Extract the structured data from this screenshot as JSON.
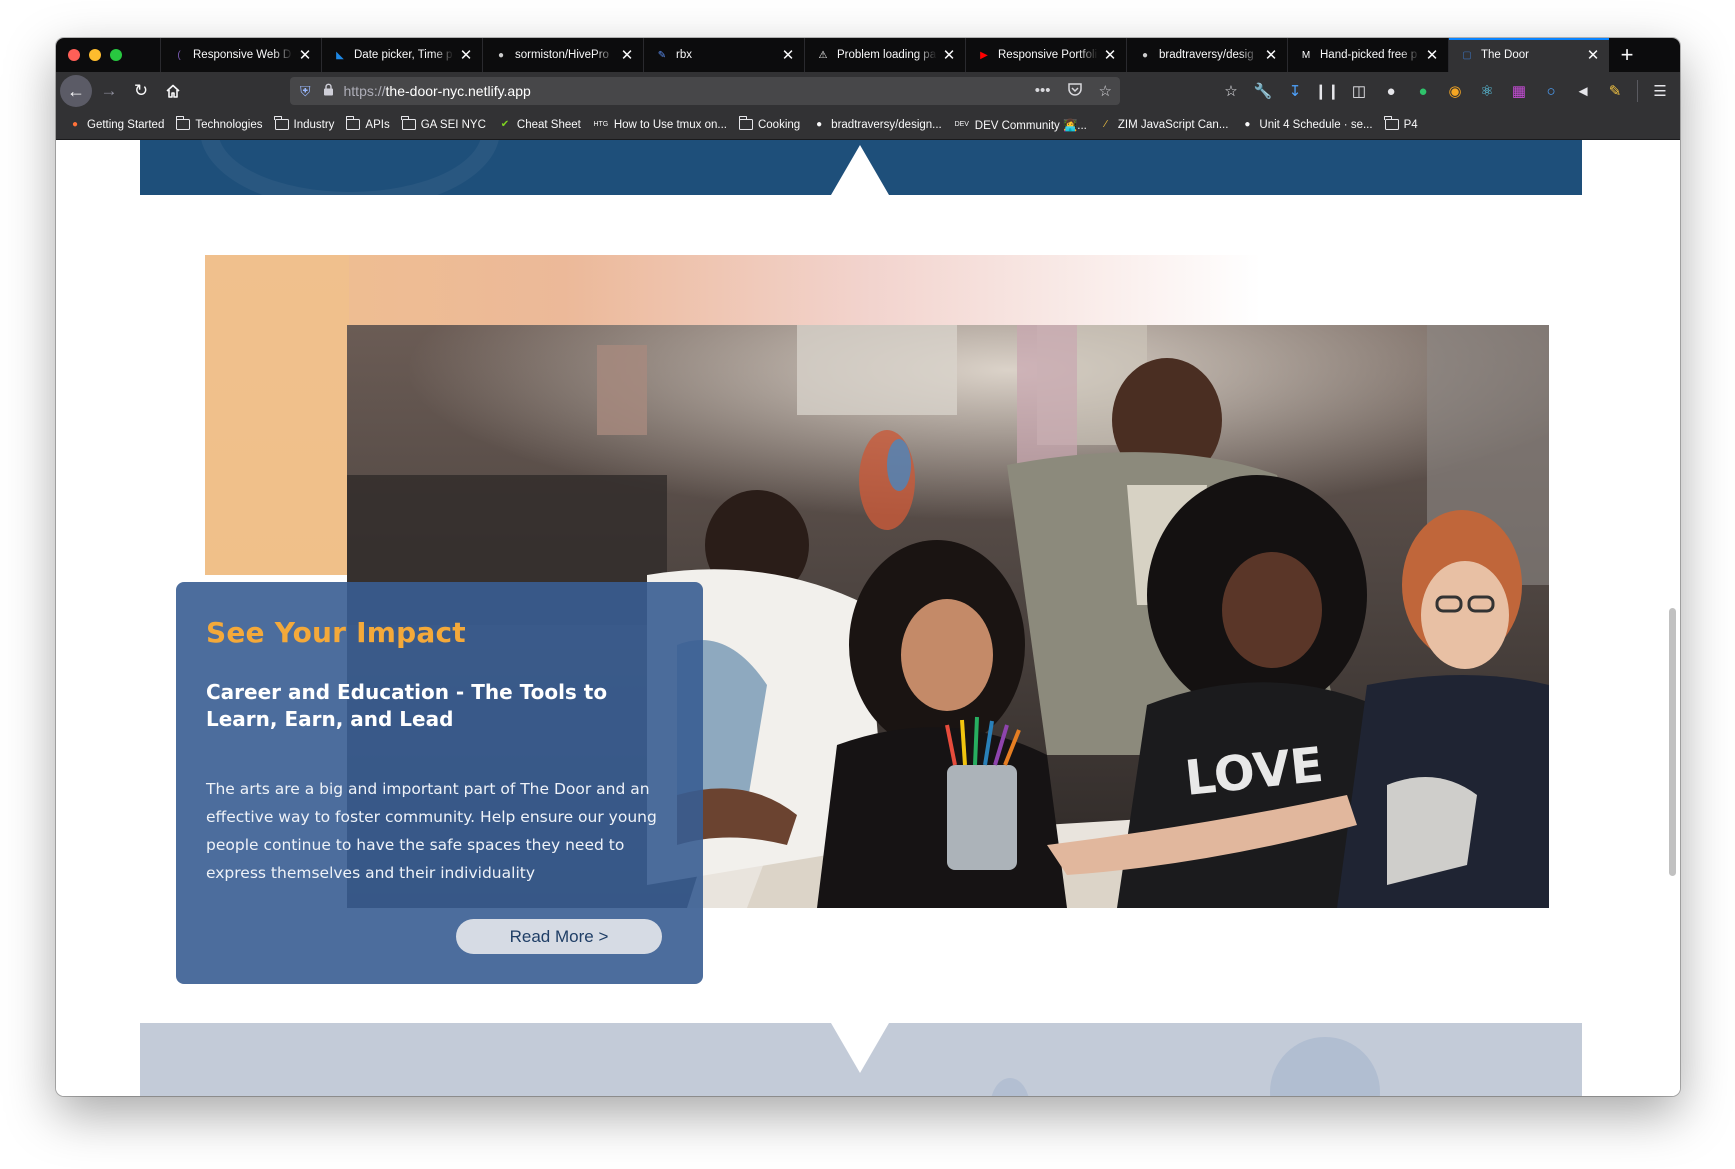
{
  "browser": {
    "tabs": [
      {
        "title": "Responsive Web D",
        "favicon": "heroku-icon",
        "color": "#7a5bb5",
        "active": false
      },
      {
        "title": "Date picker, Time p",
        "favicon": "mui-icon",
        "color": "#1e88e5",
        "active": false
      },
      {
        "title": "sormiston/HivePro",
        "favicon": "github-icon",
        "color": "#cccccc",
        "active": false
      },
      {
        "title": "rbx",
        "favicon": "rbx-icon",
        "color": "#5b8def",
        "active": false
      },
      {
        "title": "Problem loading pa",
        "favicon": "warning-icon",
        "color": "#ffffff",
        "active": false
      },
      {
        "title": "Responsive Portfoli",
        "favicon": "youtube-icon",
        "color": "#ff0000",
        "active": false
      },
      {
        "title": "bradtraversy/desig",
        "favicon": "github-icon",
        "color": "#cccccc",
        "active": false
      },
      {
        "title": "Hand-picked free p",
        "favicon": "m-icon",
        "color": "#ffffff",
        "active": false
      },
      {
        "title": "The Door",
        "favicon": "door-icon",
        "color": "#3b6fb6",
        "active": true
      }
    ],
    "url_protocol": "https://",
    "url_host": "the-door-nyc.netlify.app",
    "bookmarks": [
      {
        "label": "Getting Started",
        "icon": "firefox-icon"
      },
      {
        "label": "Technologies",
        "icon": "folder-icon"
      },
      {
        "label": "Industry",
        "icon": "folder-icon"
      },
      {
        "label": "APIs",
        "icon": "folder-icon"
      },
      {
        "label": "GA SEI NYC",
        "icon": "folder-icon"
      },
      {
        "label": "Cheat Sheet",
        "icon": "leaf-icon"
      },
      {
        "label": "How to Use tmux on...",
        "icon": "htg-icon"
      },
      {
        "label": "Cooking",
        "icon": "folder-icon"
      },
      {
        "label": "bradtraversy/design...",
        "icon": "github-icon"
      },
      {
        "label": "DEV Community 👩‍💻...",
        "icon": "dev-icon"
      },
      {
        "label": "ZIM JavaScript Can...",
        "icon": "zim-icon"
      },
      {
        "label": "Unit 4 Schedule · se...",
        "icon": "github-icon"
      },
      {
        "label": "P4",
        "icon": "folder-icon"
      }
    ]
  },
  "page": {
    "card": {
      "title": "See Your Impact",
      "subtitle": "Career and Education - The Tools to Learn, Earn, and Lead",
      "body": "The arts are a big and important part of The Door and an effective way to foster community. Help ensure our young people continue to have the safe spaces they need to express themselves and their individuality",
      "button": "Read More >"
    },
    "photo": {
      "alt": "young-people-making-art-photo"
    },
    "colors": {
      "band_dark": "#1e4f7a",
      "band_light": "#c3cbd8",
      "accent_orange": "#f4a93a",
      "card_bg": "#385d92"
    }
  }
}
